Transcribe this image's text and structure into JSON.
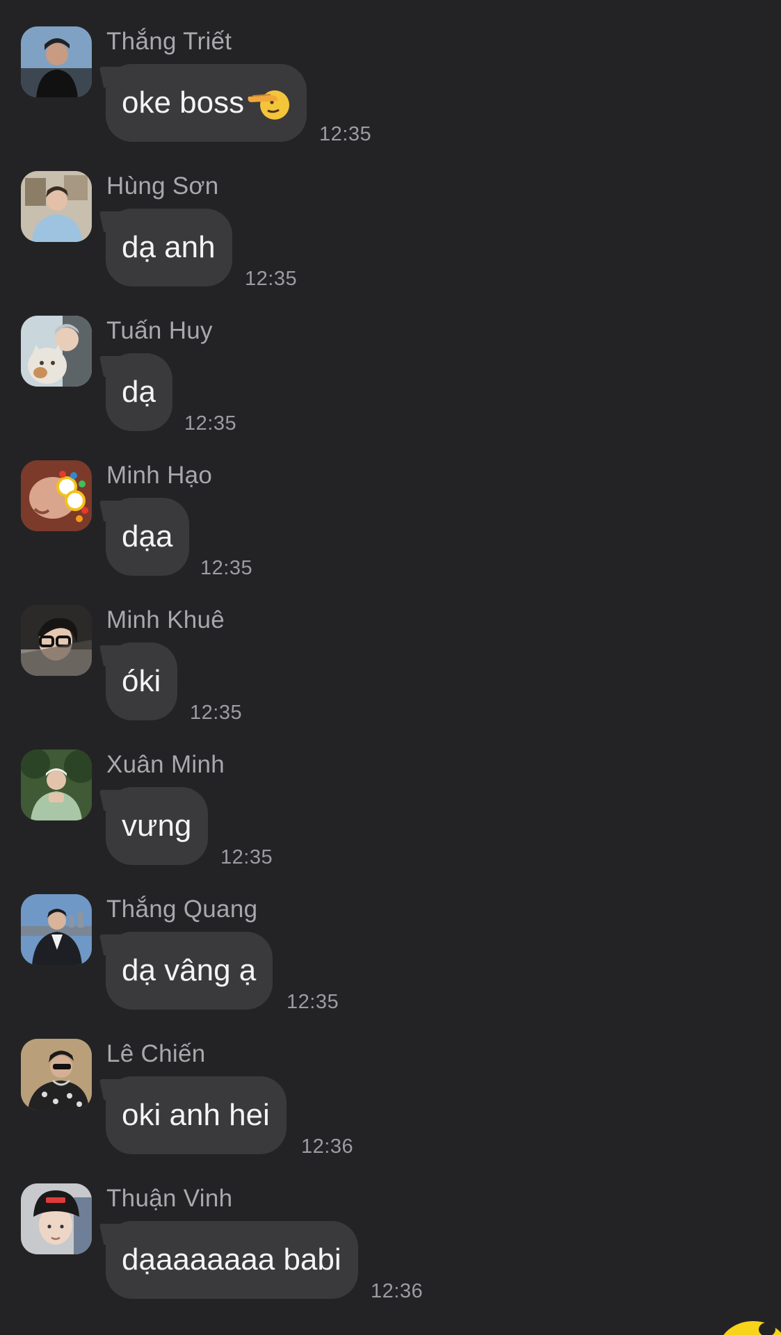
{
  "messages": [
    {
      "sender": "Thắng Triết",
      "text": "oke boss",
      "emoji": "saluting-face",
      "time": "12:35"
    },
    {
      "sender": "Hùng Sơn",
      "text": "dạ anh",
      "time": "12:35"
    },
    {
      "sender": "Tuấn Huy",
      "text": "dạ",
      "time": "12:35"
    },
    {
      "sender": "Minh Hạo",
      "text": "dạa",
      "time": "12:35"
    },
    {
      "sender": "Minh Khuê",
      "text": "óki",
      "time": "12:35"
    },
    {
      "sender": "Xuân Minh",
      "text": "vưng",
      "time": "12:35"
    },
    {
      "sender": "Thắng Quang",
      "text": "dạ vâng ạ",
      "time": "12:35"
    },
    {
      "sender": "Lê Chiến",
      "text": "oki anh hei",
      "time": "12:36"
    },
    {
      "sender": "Thuận Vinh",
      "text": "dạaaaaaaa babi",
      "time": "12:36"
    }
  ],
  "colors": {
    "background": "#232325",
    "bubble": "#3a3a3d",
    "text": "#f4f4f6",
    "sender": "#a8a8ad",
    "time": "#9c9ca2",
    "sticker": "#f7d31a"
  },
  "icons": {
    "emoji": "saluting-face-emoji",
    "corner": "sticker-icon"
  }
}
